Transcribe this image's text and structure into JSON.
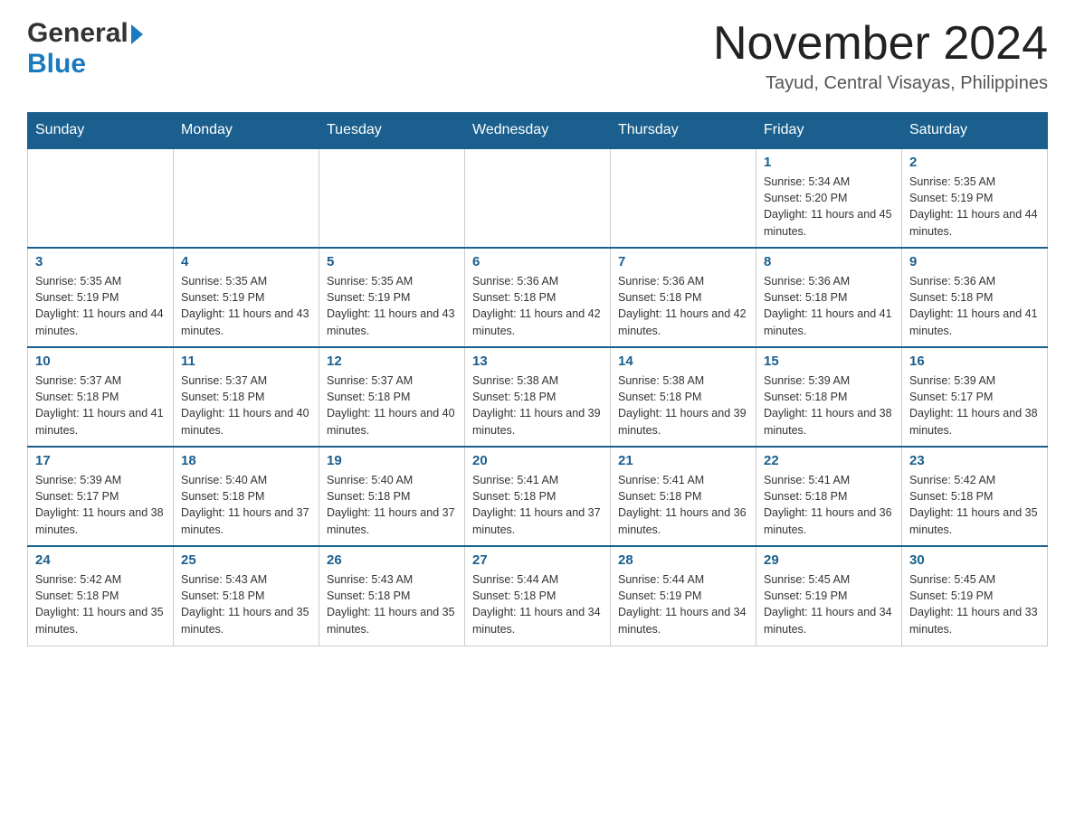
{
  "header": {
    "logo_general": "General",
    "logo_blue": "Blue",
    "month_title": "November 2024",
    "location": "Tayud, Central Visayas, Philippines"
  },
  "weekdays": [
    "Sunday",
    "Monday",
    "Tuesday",
    "Wednesday",
    "Thursday",
    "Friday",
    "Saturday"
  ],
  "weeks": [
    [
      {
        "day": "",
        "info": ""
      },
      {
        "day": "",
        "info": ""
      },
      {
        "day": "",
        "info": ""
      },
      {
        "day": "",
        "info": ""
      },
      {
        "day": "",
        "info": ""
      },
      {
        "day": "1",
        "info": "Sunrise: 5:34 AM\nSunset: 5:20 PM\nDaylight: 11 hours and 45 minutes."
      },
      {
        "day": "2",
        "info": "Sunrise: 5:35 AM\nSunset: 5:19 PM\nDaylight: 11 hours and 44 minutes."
      }
    ],
    [
      {
        "day": "3",
        "info": "Sunrise: 5:35 AM\nSunset: 5:19 PM\nDaylight: 11 hours and 44 minutes."
      },
      {
        "day": "4",
        "info": "Sunrise: 5:35 AM\nSunset: 5:19 PM\nDaylight: 11 hours and 43 minutes."
      },
      {
        "day": "5",
        "info": "Sunrise: 5:35 AM\nSunset: 5:19 PM\nDaylight: 11 hours and 43 minutes."
      },
      {
        "day": "6",
        "info": "Sunrise: 5:36 AM\nSunset: 5:18 PM\nDaylight: 11 hours and 42 minutes."
      },
      {
        "day": "7",
        "info": "Sunrise: 5:36 AM\nSunset: 5:18 PM\nDaylight: 11 hours and 42 minutes."
      },
      {
        "day": "8",
        "info": "Sunrise: 5:36 AM\nSunset: 5:18 PM\nDaylight: 11 hours and 41 minutes."
      },
      {
        "day": "9",
        "info": "Sunrise: 5:36 AM\nSunset: 5:18 PM\nDaylight: 11 hours and 41 minutes."
      }
    ],
    [
      {
        "day": "10",
        "info": "Sunrise: 5:37 AM\nSunset: 5:18 PM\nDaylight: 11 hours and 41 minutes."
      },
      {
        "day": "11",
        "info": "Sunrise: 5:37 AM\nSunset: 5:18 PM\nDaylight: 11 hours and 40 minutes."
      },
      {
        "day": "12",
        "info": "Sunrise: 5:37 AM\nSunset: 5:18 PM\nDaylight: 11 hours and 40 minutes."
      },
      {
        "day": "13",
        "info": "Sunrise: 5:38 AM\nSunset: 5:18 PM\nDaylight: 11 hours and 39 minutes."
      },
      {
        "day": "14",
        "info": "Sunrise: 5:38 AM\nSunset: 5:18 PM\nDaylight: 11 hours and 39 minutes."
      },
      {
        "day": "15",
        "info": "Sunrise: 5:39 AM\nSunset: 5:18 PM\nDaylight: 11 hours and 38 minutes."
      },
      {
        "day": "16",
        "info": "Sunrise: 5:39 AM\nSunset: 5:17 PM\nDaylight: 11 hours and 38 minutes."
      }
    ],
    [
      {
        "day": "17",
        "info": "Sunrise: 5:39 AM\nSunset: 5:17 PM\nDaylight: 11 hours and 38 minutes."
      },
      {
        "day": "18",
        "info": "Sunrise: 5:40 AM\nSunset: 5:18 PM\nDaylight: 11 hours and 37 minutes."
      },
      {
        "day": "19",
        "info": "Sunrise: 5:40 AM\nSunset: 5:18 PM\nDaylight: 11 hours and 37 minutes."
      },
      {
        "day": "20",
        "info": "Sunrise: 5:41 AM\nSunset: 5:18 PM\nDaylight: 11 hours and 37 minutes."
      },
      {
        "day": "21",
        "info": "Sunrise: 5:41 AM\nSunset: 5:18 PM\nDaylight: 11 hours and 36 minutes."
      },
      {
        "day": "22",
        "info": "Sunrise: 5:41 AM\nSunset: 5:18 PM\nDaylight: 11 hours and 36 minutes."
      },
      {
        "day": "23",
        "info": "Sunrise: 5:42 AM\nSunset: 5:18 PM\nDaylight: 11 hours and 35 minutes."
      }
    ],
    [
      {
        "day": "24",
        "info": "Sunrise: 5:42 AM\nSunset: 5:18 PM\nDaylight: 11 hours and 35 minutes."
      },
      {
        "day": "25",
        "info": "Sunrise: 5:43 AM\nSunset: 5:18 PM\nDaylight: 11 hours and 35 minutes."
      },
      {
        "day": "26",
        "info": "Sunrise: 5:43 AM\nSunset: 5:18 PM\nDaylight: 11 hours and 35 minutes."
      },
      {
        "day": "27",
        "info": "Sunrise: 5:44 AM\nSunset: 5:18 PM\nDaylight: 11 hours and 34 minutes."
      },
      {
        "day": "28",
        "info": "Sunrise: 5:44 AM\nSunset: 5:19 PM\nDaylight: 11 hours and 34 minutes."
      },
      {
        "day": "29",
        "info": "Sunrise: 5:45 AM\nSunset: 5:19 PM\nDaylight: 11 hours and 34 minutes."
      },
      {
        "day": "30",
        "info": "Sunrise: 5:45 AM\nSunset: 5:19 PM\nDaylight: 11 hours and 33 minutes."
      }
    ]
  ]
}
